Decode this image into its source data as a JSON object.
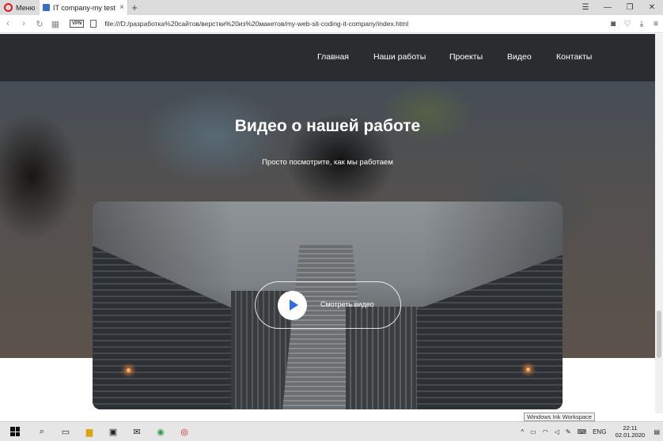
{
  "browser": {
    "menu_label": "Меню",
    "tab_title": "IT company-my test web si",
    "tab_close": "×",
    "new_tab": "+",
    "url": "file:///D:/разработка%20сайтов/верстки%20из%20макетов/my-web-sit-coding-it-company/index.html",
    "vpn_label": "VPN",
    "icons": [
      "opera-icon",
      "back-icon",
      "forward-icon",
      "reload-icon",
      "tabs-grid-icon",
      "vpn-icon",
      "file-icon",
      "camera-icon",
      "heart-icon",
      "download-icon",
      "menu-icon",
      "minimize-icon",
      "restore-icon",
      "close-icon"
    ]
  },
  "nav": {
    "items": [
      {
        "label": "Главная"
      },
      {
        "label": "Наши работы"
      },
      {
        "label": "Проекты"
      },
      {
        "label": "Видео"
      },
      {
        "label": "Контакты"
      }
    ],
    "background": "#2b2c30"
  },
  "hero": {
    "title": "Видео о нашей работе",
    "subtitle": "Просто посмотрите, как мы работаем"
  },
  "video": {
    "button_label": "Смотреть видео",
    "play_color": "#2f6de0"
  },
  "taskbar": {
    "tooltip": "Windows Ink Workspace",
    "language": "ENG",
    "time": "22:11",
    "date": "02.01.2020"
  }
}
